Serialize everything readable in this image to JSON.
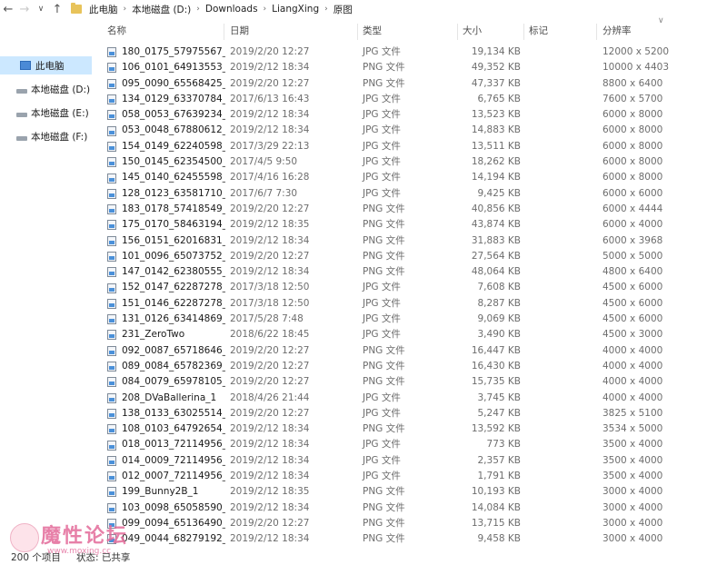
{
  "nav": {
    "back": "←",
    "forward": "→",
    "dropdown": "∨",
    "up": "↑"
  },
  "breadcrumb": [
    "此电脑",
    "本地磁盘 (D:)",
    "Downloads",
    "LiangXing",
    "原图"
  ],
  "breadcrumb_sep": "›",
  "sidebar": {
    "selected": "此电脑",
    "drives": [
      "本地磁盘 (D:)",
      "本地磁盘 (E:)",
      "本地磁盘 (F:)"
    ]
  },
  "columns": {
    "name": "名称",
    "date": "日期",
    "type": "类型",
    "size": "大小",
    "tag": "标记",
    "resolution": "分辨率"
  },
  "sort_indicator": "∨",
  "files": [
    {
      "name": "180_0175_57975567_",
      "date": "2019/2/20 12:27",
      "type": "JPG 文件",
      "size": "19,134 KB",
      "res": "12000 x 5200"
    },
    {
      "name": "106_0101_64913553_",
      "date": "2019/2/12 18:34",
      "type": "PNG 文件",
      "size": "49,352 KB",
      "res": "10000 x 4403"
    },
    {
      "name": "095_0090_65568425_",
      "date": "2019/2/20 12:27",
      "type": "PNG 文件",
      "size": "47,337 KB",
      "res": "8800 x 6400"
    },
    {
      "name": "134_0129_63370784_",
      "date": "2017/6/13 16:43",
      "type": "JPG 文件",
      "size": "6,765 KB",
      "res": "7600 x 5700"
    },
    {
      "name": "058_0053_67639234_",
      "date": "2019/2/12 18:34",
      "type": "JPG 文件",
      "size": "13,523 KB",
      "res": "6000 x 8000"
    },
    {
      "name": "053_0048_67880612_",
      "date": "2019/2/12 18:34",
      "type": "JPG 文件",
      "size": "14,883 KB",
      "res": "6000 x 8000"
    },
    {
      "name": "154_0149_62240598_",
      "date": "2017/3/29 22:13",
      "type": "JPG 文件",
      "size": "13,511 KB",
      "res": "6000 x 8000"
    },
    {
      "name": "150_0145_62354500_",
      "date": "2017/4/5 9:50",
      "type": "JPG 文件",
      "size": "18,262 KB",
      "res": "6000 x 8000"
    },
    {
      "name": "145_0140_62455598_",
      "date": "2017/4/16 16:28",
      "type": "JPG 文件",
      "size": "14,194 KB",
      "res": "6000 x 8000"
    },
    {
      "name": "128_0123_63581710_",
      "date": "2017/6/7 7:30",
      "type": "JPG 文件",
      "size": "9,425 KB",
      "res": "6000 x 6000"
    },
    {
      "name": "183_0178_57418549_",
      "date": "2019/2/20 12:27",
      "type": "PNG 文件",
      "size": "40,856 KB",
      "res": "6000 x 4444"
    },
    {
      "name": "175_0170_58463194_",
      "date": "2019/2/12 18:35",
      "type": "PNG 文件",
      "size": "43,874 KB",
      "res": "6000 x 4000"
    },
    {
      "name": "156_0151_62016831_",
      "date": "2019/2/12 18:34",
      "type": "PNG 文件",
      "size": "31,883 KB",
      "res": "6000 x 3968"
    },
    {
      "name": "101_0096_65073752_",
      "date": "2019/2/20 12:27",
      "type": "PNG 文件",
      "size": "27,564 KB",
      "res": "5000 x 5000"
    },
    {
      "name": "147_0142_62380555_",
      "date": "2019/2/12 18:34",
      "type": "PNG 文件",
      "size": "48,064 KB",
      "res": "4800 x 6400"
    },
    {
      "name": "152_0147_62287278_",
      "date": "2017/3/18 12:50",
      "type": "JPG 文件",
      "size": "7,608 KB",
      "res": "4500 x 6000"
    },
    {
      "name": "151_0146_62287278_",
      "date": "2017/3/18 12:50",
      "type": "JPG 文件",
      "size": "8,287 KB",
      "res": "4500 x 6000"
    },
    {
      "name": "131_0126_63414869_",
      "date": "2017/5/28 7:48",
      "type": "JPG 文件",
      "size": "9,069 KB",
      "res": "4500 x 6000"
    },
    {
      "name": "231_ZeroTwo",
      "date": "2018/6/22 18:45",
      "type": "JPG 文件",
      "size": "3,490 KB",
      "res": "4500 x 3000"
    },
    {
      "name": "092_0087_65718646_",
      "date": "2019/2/20 12:27",
      "type": "PNG 文件",
      "size": "16,447 KB",
      "res": "4000 x 4000"
    },
    {
      "name": "089_0084_65782369_",
      "date": "2019/2/20 12:27",
      "type": "PNG 文件",
      "size": "16,430 KB",
      "res": "4000 x 4000"
    },
    {
      "name": "084_0079_65978105_",
      "date": "2019/2/20 12:27",
      "type": "PNG 文件",
      "size": "15,735 KB",
      "res": "4000 x 4000"
    },
    {
      "name": "208_DVaBallerina_1",
      "date": "2018/4/26 21:44",
      "type": "JPG 文件",
      "size": "3,745 KB",
      "res": "4000 x 4000"
    },
    {
      "name": "138_0133_63025514_",
      "date": "2019/2/20 12:27",
      "type": "JPG 文件",
      "size": "5,247 KB",
      "res": "3825 x 5100"
    },
    {
      "name": "108_0103_64792654_",
      "date": "2019/2/12 18:34",
      "type": "PNG 文件",
      "size": "13,592 KB",
      "res": "3534 x 5000"
    },
    {
      "name": "018_0013_72114956_",
      "date": "2019/2/12 18:34",
      "type": "JPG 文件",
      "size": "773 KB",
      "res": "3500 x 4000"
    },
    {
      "name": "014_0009_72114956_",
      "date": "2019/2/12 18:34",
      "type": "JPG 文件",
      "size": "2,357 KB",
      "res": "3500 x 4000"
    },
    {
      "name": "012_0007_72114956_",
      "date": "2019/2/12 18:34",
      "type": "JPG 文件",
      "size": "1,791 KB",
      "res": "3500 x 4000"
    },
    {
      "name": "199_Bunny2B_1",
      "date": "2019/2/12 18:35",
      "type": "PNG 文件",
      "size": "10,193 KB",
      "res": "3000 x 4000"
    },
    {
      "name": "103_0098_65058590_",
      "date": "2019/2/12 18:34",
      "type": "PNG 文件",
      "size": "14,084 KB",
      "res": "3000 x 4000"
    },
    {
      "name": "099_0094_65136490_",
      "date": "2019/2/20 12:27",
      "type": "PNG 文件",
      "size": "13,715 KB",
      "res": "3000 x 4000"
    },
    {
      "name": "049_0044_68279192_",
      "date": "2019/2/12 18:34",
      "type": "PNG 文件",
      "size": "9,458 KB",
      "res": "3000 x 4000"
    }
  ],
  "status": {
    "count": "200 个项目",
    "share": "状态: 已共享"
  },
  "watermark": {
    "chars": [
      "魔",
      "性",
      "论",
      "坛"
    ],
    "url": "www.moxing.cc"
  }
}
